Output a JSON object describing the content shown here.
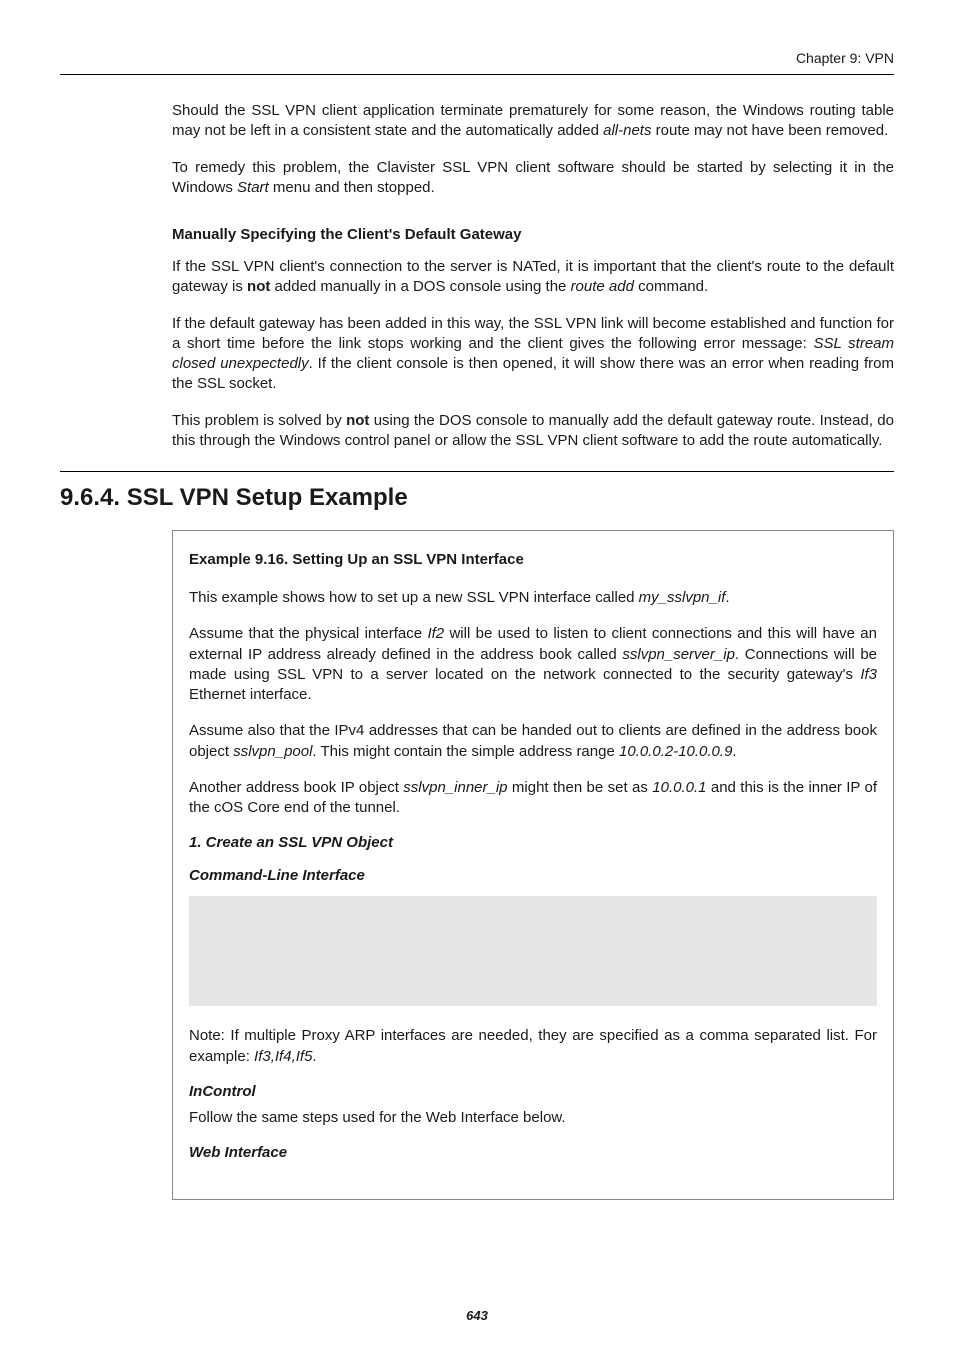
{
  "header": {
    "chapter": "Chapter 9: VPN"
  },
  "body": {
    "p1a": "Should the SSL VPN client application terminate prematurely for some reason, the Windows routing table may not be left in a consistent state and the automatically added ",
    "p1b": "all-nets",
    "p1c": " route may not have been removed.",
    "p2a": "To remedy this problem, the Clavister SSL VPN client software should be started by selecting it in the Windows ",
    "p2b": "Start",
    "p2c": " menu and then stopped.",
    "h_manual": "Manually Specifying the Client's Default Gateway",
    "p3a": "If the SSL VPN client's connection to the server is NATed, it is important that the client's route to the default gateway is ",
    "p3b": "not",
    "p3c": " added manually in a DOS console using the ",
    "p3d": "route add",
    "p3e": " command.",
    "p4a": "If the default gateway has been added in this way, the SSL VPN link will become established and function for a short time before the link stops working and the client gives the following error message: ",
    "p4b": "SSL stream closed unexpectedly",
    "p4c": ". If the client console is then opened, it will show there was an error when reading from the SSL socket.",
    "p5a": "This problem is solved by ",
    "p5b": "not",
    "p5c": " using the DOS console to manually add the default gateway route. Instead, do this through the Windows control panel or allow the SSL VPN client software to add the route automatically."
  },
  "section": {
    "title": "9.6.4. SSL VPN Setup Example"
  },
  "example": {
    "title": "Example 9.16. Setting Up an SSL VPN Interface",
    "p1a": "This example shows how to set up a new SSL VPN interface called ",
    "p1b": "my_sslvpn_if",
    "p1c": ".",
    "p2a": "Assume that the physical interface ",
    "p2b": "If2",
    "p2c": " will be used to listen to client connections and this will have an external IP address already defined in the address book called ",
    "p2d": "sslvpn_server_ip",
    "p2e": ". Connections will be made using SSL VPN to a server located on the network connected to the security gateway's ",
    "p2f": "If3",
    "p2g": " Ethernet interface.",
    "p3a": "Assume also that the IPv4 addresses that can be handed out to clients are defined in the address book object ",
    "p3b": "sslvpn_pool",
    "p3c": ". This might contain the simple address range ",
    "p3d": "10.0.0.2-10.0.0.9",
    "p3e": ".",
    "p4a": "Another address book IP object ",
    "p4b": "sslvpn_inner_ip",
    "p4c": " might then be set as ",
    "p4d": "10.0.0.1",
    "p4e": " and this is the inner IP of the cOS Core end of the tunnel.",
    "step1": "1. Create an SSL VPN Object",
    "cli": "Command-Line Interface",
    "note_a": "Note: If multiple Proxy ARP interfaces are needed, they are specified as a comma separated list. For example: ",
    "note_b": "If3,If4,If5",
    "note_c": ".",
    "incontrol_h": "InControl",
    "incontrol_p": "Follow the same steps used for the Web Interface below.",
    "web": "Web Interface"
  },
  "footer": {
    "pagenum": "643"
  }
}
